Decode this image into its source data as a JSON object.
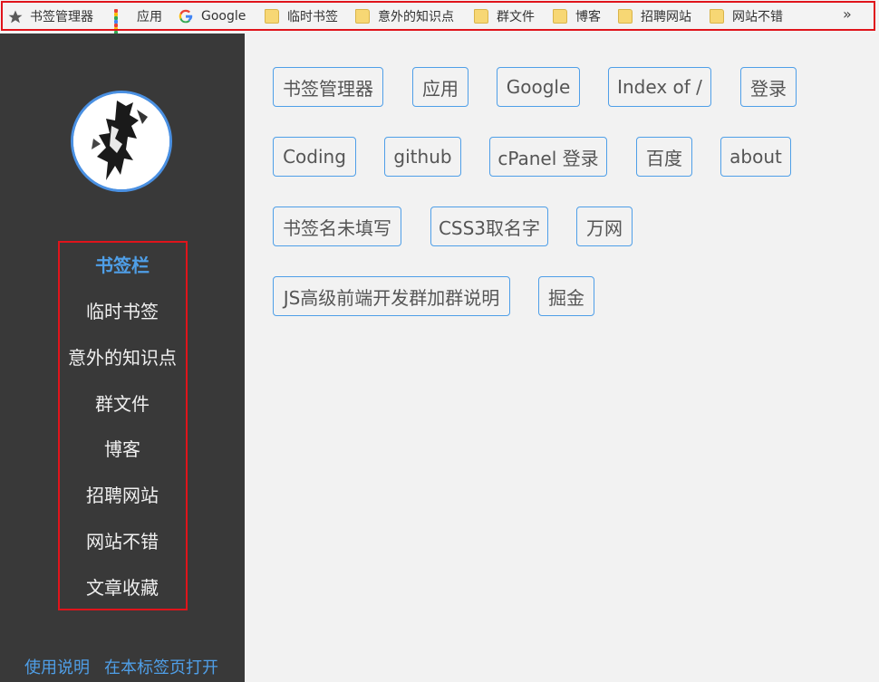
{
  "bookmarks_bar": {
    "items": [
      {
        "label": "书签管理器",
        "icon": "star-icon"
      },
      {
        "label": "应用",
        "icon": "apps-grid-icon"
      },
      {
        "label": "Google",
        "icon": "google-icon"
      },
      {
        "label": "临时书签",
        "icon": "folder-icon"
      },
      {
        "label": "意外的知识点",
        "icon": "folder-icon"
      },
      {
        "label": "群文件",
        "icon": "folder-icon"
      },
      {
        "label": "博客",
        "icon": "folder-icon"
      },
      {
        "label": "招聘网站",
        "icon": "folder-icon"
      },
      {
        "label": "网站不错",
        "icon": "folder-icon"
      }
    ],
    "overflow": "»"
  },
  "sidebar": {
    "nav": [
      {
        "label": "书签栏"
      },
      {
        "label": "临时书签"
      },
      {
        "label": "意外的知识点"
      },
      {
        "label": "群文件"
      },
      {
        "label": "博客"
      },
      {
        "label": "招聘网站"
      },
      {
        "label": "网站不错"
      },
      {
        "label": "文章收藏"
      }
    ],
    "bottom_links": [
      {
        "label": "使用说明"
      },
      {
        "label": "在本标签页打开"
      }
    ]
  },
  "main": {
    "bookmarks": [
      {
        "label": "书签管理器"
      },
      {
        "label": "应用"
      },
      {
        "label": "Google"
      },
      {
        "label": "Index of /"
      },
      {
        "label": "登录"
      },
      {
        "label": "Coding"
      },
      {
        "label": "github"
      },
      {
        "label": "cPanel 登录"
      },
      {
        "label": "百度"
      },
      {
        "label": "about"
      },
      {
        "label": "书签名未填写"
      },
      {
        "label": "CSS3取名字"
      },
      {
        "label": "万网"
      },
      {
        "label": "JS高级前端开发群加群说明"
      },
      {
        "label": "掘金"
      }
    ]
  },
  "colors": {
    "accent": "#4f9fe8",
    "sidebar_bg": "#393939",
    "highlight_frame": "#e0141b",
    "page_bg": "#f2f2f2"
  }
}
